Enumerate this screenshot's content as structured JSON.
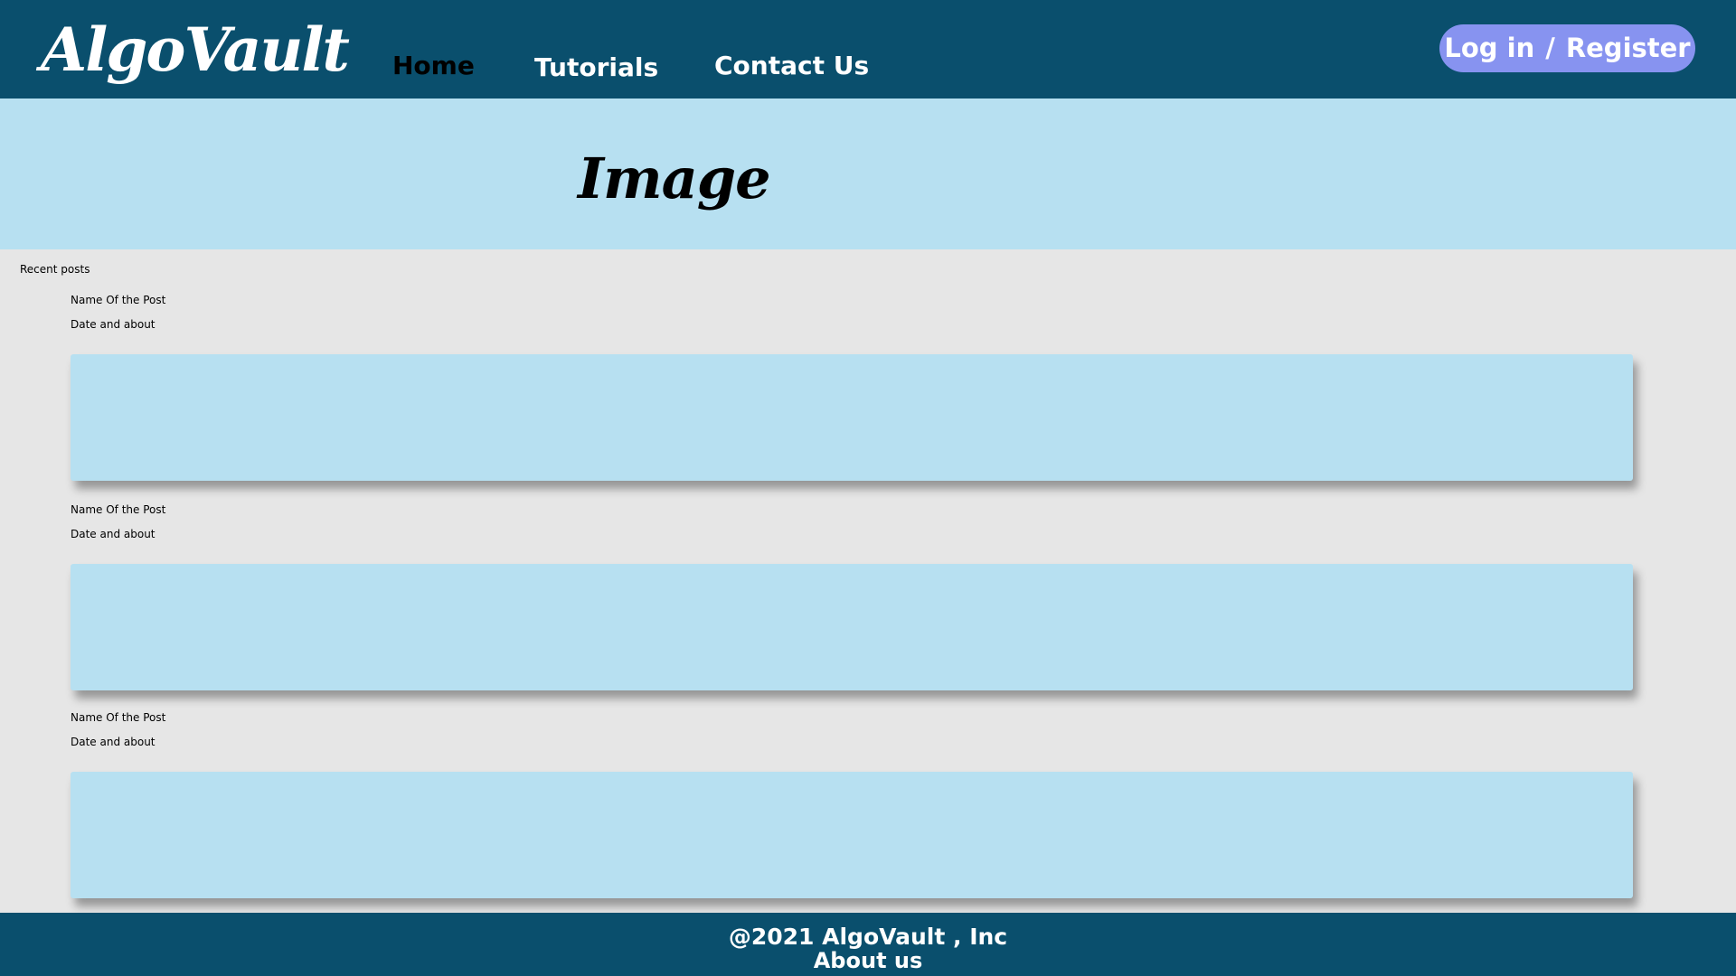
{
  "header": {
    "logo": "AlgoVault",
    "nav": [
      {
        "label": "Home",
        "active": true
      },
      {
        "label": "Tutorials",
        "active": false
      },
      {
        "label": "Contact Us",
        "active": false
      }
    ],
    "auth": {
      "login": "Log in",
      "separator": "/",
      "register": "Register"
    }
  },
  "banner": {
    "title": "Image"
  },
  "posts": {
    "section_label": "Recent posts",
    "items": [
      {
        "name": "Name Of the Post",
        "meta": "Date  and about"
      },
      {
        "name": "Name Of the Post",
        "meta": "Date  and about"
      },
      {
        "name": "Name Of the Post",
        "meta": "Date  and about"
      }
    ]
  },
  "footer": {
    "copyright": "@2021 AlgoVault , Inc",
    "about": "About us"
  },
  "colors": {
    "header_bg": "#0a4f6d",
    "banner_bg": "#b7e0f1",
    "page_bg": "#e6e6e6",
    "auth_pill": "#8793f0",
    "nav_active": "#000000",
    "nav_text": "#ffffff"
  }
}
